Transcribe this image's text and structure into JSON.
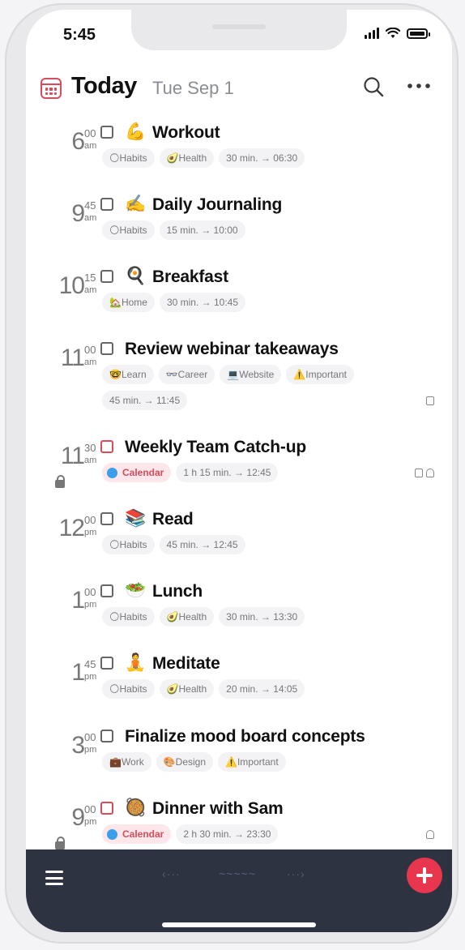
{
  "status": {
    "time": "5:45"
  },
  "header": {
    "title": "Today",
    "date": "Tue Sep 1"
  },
  "icons": {
    "calendar": "calendar-icon",
    "search": "search-icon",
    "more": "more-horizontal-icon",
    "menu": "menu-icon",
    "add": "plus-icon",
    "lock": "lock-icon",
    "note": "note-icon",
    "bell": "bell-icon"
  },
  "colors": {
    "accent": "#e8364e",
    "calendar_tag_bg": "#fde7ea",
    "calendar_tag_text": "#d94c5c",
    "calendar_dot": "#3b9eea",
    "tabbar": "#2d3340"
  },
  "tasks": [
    {
      "hour": "6",
      "min": "00",
      "ampm": "am",
      "emoji": "💪",
      "title": "Workout",
      "tags": [
        "🌕Habits",
        "🥑Health",
        "30 min. → 06:30"
      ]
    },
    {
      "hour": "9",
      "min": "45",
      "ampm": "am",
      "emoji": "✍️",
      "title": "Daily Journaling",
      "tags": [
        "🌕Habits",
        "15 min. → 10:00"
      ]
    },
    {
      "hour": "10",
      "min": "15",
      "ampm": "am",
      "emoji": "🍳",
      "title": "Breakfast",
      "tags": [
        "🏡Home",
        "30 min. → 10:45"
      ]
    },
    {
      "hour": "11",
      "min": "00",
      "ampm": "am",
      "emoji": "",
      "title": "Review webinar takeaways",
      "tags": [
        "🤓Learn",
        "👓Career",
        "💻Website",
        "⚠️Important"
      ],
      "tags2": [
        "45 min. → 11:45"
      ]
    },
    {
      "hour": "11",
      "min": "30",
      "ampm": "am",
      "emoji": "",
      "title": "Weekly Team Catch-up",
      "calendar_tag": "Calendar",
      "tags": [
        "1 h 15 min. → 12:45"
      ]
    },
    {
      "hour": "12",
      "min": "00",
      "ampm": "pm",
      "emoji": "📚",
      "title": "Read",
      "tags": [
        "🌕Habits",
        "45 min. → 12:45"
      ]
    },
    {
      "hour": "1",
      "min": "00",
      "ampm": "pm",
      "emoji": "🥗",
      "title": "Lunch",
      "tags": [
        "🌕Habits",
        "🥑Health",
        "30 min. → 13:30"
      ]
    },
    {
      "hour": "1",
      "min": "45",
      "ampm": "pm",
      "emoji": "🧘",
      "title": "Meditate",
      "tags": [
        "🌕Habits",
        "🥑Health",
        "20 min. → 14:05"
      ]
    },
    {
      "hour": "3",
      "min": "00",
      "ampm": "pm",
      "emoji": "",
      "title": "Finalize mood board concepts",
      "tags": [
        "💼Work",
        "🎨Design",
        "⚠️Important"
      ]
    },
    {
      "hour": "9",
      "min": "00",
      "ampm": "pm",
      "emoji": "🥘",
      "title": "Dinner with Sam",
      "calendar_tag": "Calendar",
      "tags": [
        "2 h 30 min. → 23:30"
      ]
    }
  ],
  "tabbar": {
    "nav_prev": "‹···",
    "nav_mid": "~~~~~",
    "nav_next": "···›"
  }
}
